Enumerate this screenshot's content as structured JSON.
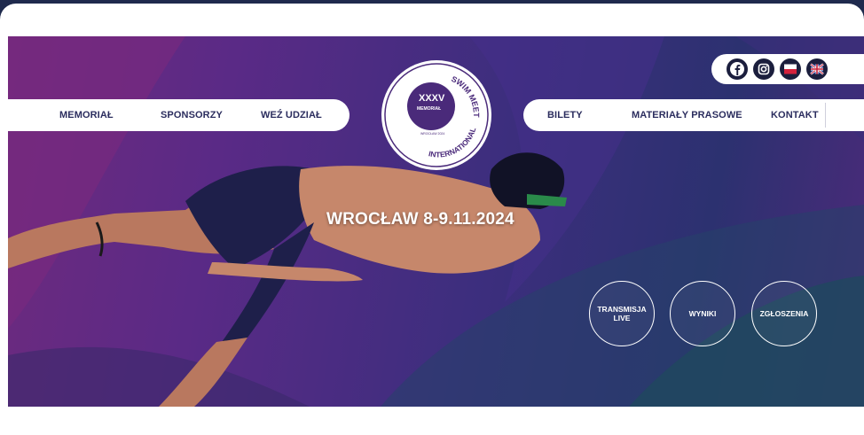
{
  "nav_left": [
    {
      "label": "MEMORIAŁ"
    },
    {
      "label": "SPONSORZY"
    },
    {
      "label": "WEŹ UDZIAŁ"
    }
  ],
  "nav_right": [
    {
      "label": "BILETY"
    },
    {
      "label": "MATERIAŁY PRASOWE"
    },
    {
      "label": "KONTAKT"
    }
  ],
  "logo": {
    "roman": "XXXV",
    "line1": "MEMORIAŁ",
    "arc_top": "SWIM MEET",
    "arc_bottom": "INTERNATIONAL",
    "year_tag": "WROCŁAW 2024"
  },
  "socials": [
    {
      "icon": "facebook-icon"
    },
    {
      "icon": "instagram-icon"
    },
    {
      "icon": "poland-flag-icon"
    },
    {
      "icon": "uk-flag-icon"
    }
  ],
  "headline": "WROCŁAW 8-9.11.2024",
  "actions": [
    {
      "label": "TRANSMISJA\nLIVE"
    },
    {
      "label": "WYNIKI"
    },
    {
      "label": "ZGŁOSZENIA"
    }
  ],
  "colors": {
    "navy": "#2b2d5e",
    "purple": "#5a2a86",
    "magenta": "#8a2a7a",
    "teal": "#1f4a5e"
  }
}
